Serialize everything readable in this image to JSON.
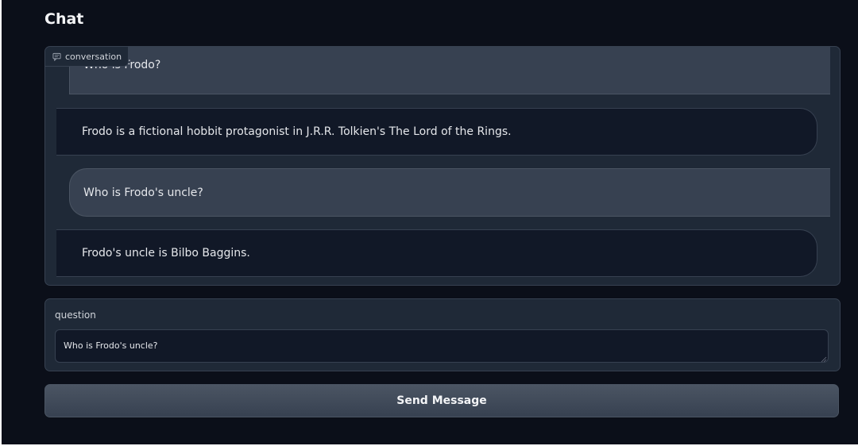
{
  "header": {
    "title": "Chat"
  },
  "chatbot": {
    "label": "conversation",
    "label_icon": "chat-bubble-icon",
    "messages": [
      {
        "role": "user",
        "text": "Who is Frodo?"
      },
      {
        "role": "bot",
        "text": "Frodo is a fictional hobbit protagonist in J.R.R. Tolkien's The Lord of the Rings."
      },
      {
        "role": "user",
        "text": "Who is Frodo's uncle?"
      },
      {
        "role": "bot",
        "text": "Frodo's uncle is Bilbo Baggins."
      }
    ]
  },
  "question": {
    "label": "question",
    "value": "Who is Frodo's uncle?"
  },
  "send_button": {
    "label": "Send Message"
  },
  "colors": {
    "background": "#0b0f19",
    "panel": "#1f2937",
    "user_bubble": "#374151",
    "bot_bubble": "#111827"
  }
}
